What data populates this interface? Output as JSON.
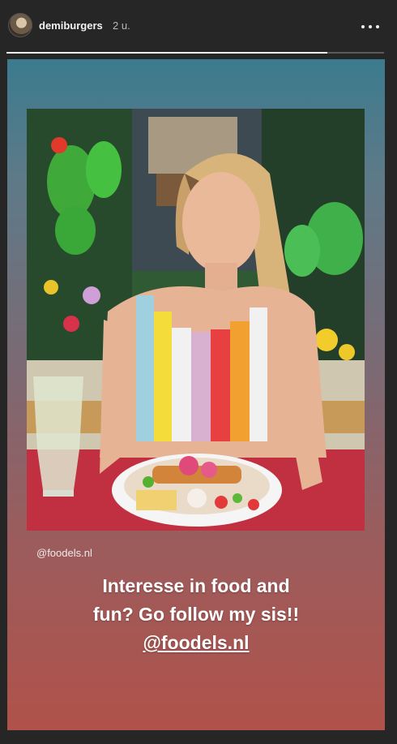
{
  "header": {
    "username": "demiburgers",
    "time": "2 u.",
    "more_icon": "more-horizontal-icon",
    "progress": 0.85
  },
  "story": {
    "small_tag": "@foodels.nl",
    "caption_line1": "Interesse in food and",
    "caption_line2": "fun? Go follow my sis!!",
    "caption_mention": "@foodels.nl"
  }
}
